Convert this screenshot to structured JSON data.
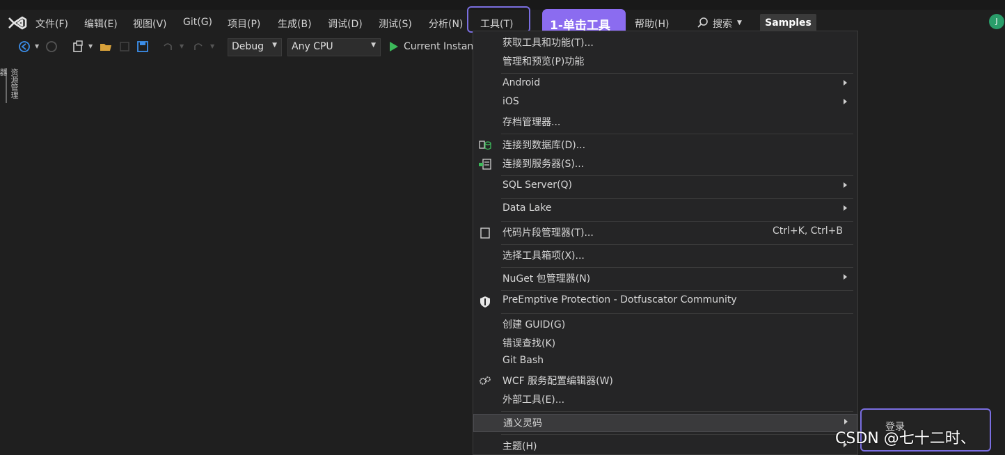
{
  "menubar": {
    "items": [
      "文件(F)",
      "编辑(E)",
      "视图(V)",
      "Git(G)",
      "项目(P)",
      "生成(B)",
      "调试(D)",
      "测试(S)",
      "分析(N)",
      "工具(T)",
      "帮助(H)"
    ],
    "search_label": "搜索",
    "samples_label": "Samples",
    "avatar_letter": "J"
  },
  "annotation": {
    "tooltip": "1-单击工具"
  },
  "toolbar": {
    "config": "Debug",
    "platform": "Any CPU",
    "run_label": "Current Instan"
  },
  "side_tab": "资源管理器",
  "dropdown": {
    "items": [
      {
        "label": "获取工具和功能(T)..."
      },
      {
        "label": "管理和预览(P)功能"
      },
      {
        "label": "Android"
      },
      {
        "label": "iOS"
      },
      {
        "label": "存档管理器..."
      },
      {
        "label": "连接到数据库(D)..."
      },
      {
        "label": "连接到服务器(S)..."
      },
      {
        "label": "SQL Server(Q)"
      },
      {
        "label": "Data Lake"
      },
      {
        "label": "代码片段管理器(T)...",
        "shortcut": "Ctrl+K, Ctrl+B"
      },
      {
        "label": "选择工具箱项(X)..."
      },
      {
        "label": "NuGet 包管理器(N)"
      },
      {
        "label": "PreEmptive Protection - Dotfuscator Community"
      },
      {
        "label": "创建 GUID(G)"
      },
      {
        "label": "错误查找(K)"
      },
      {
        "label": "Git Bash"
      },
      {
        "label": "WCF 服务配置编辑器(W)"
      },
      {
        "label": "外部工具(E)..."
      },
      {
        "label": "通义灵码"
      },
      {
        "label": "主题(H)"
      }
    ]
  },
  "submenu": {
    "label": "登录"
  },
  "watermark": "CSDN @七十二时、"
}
